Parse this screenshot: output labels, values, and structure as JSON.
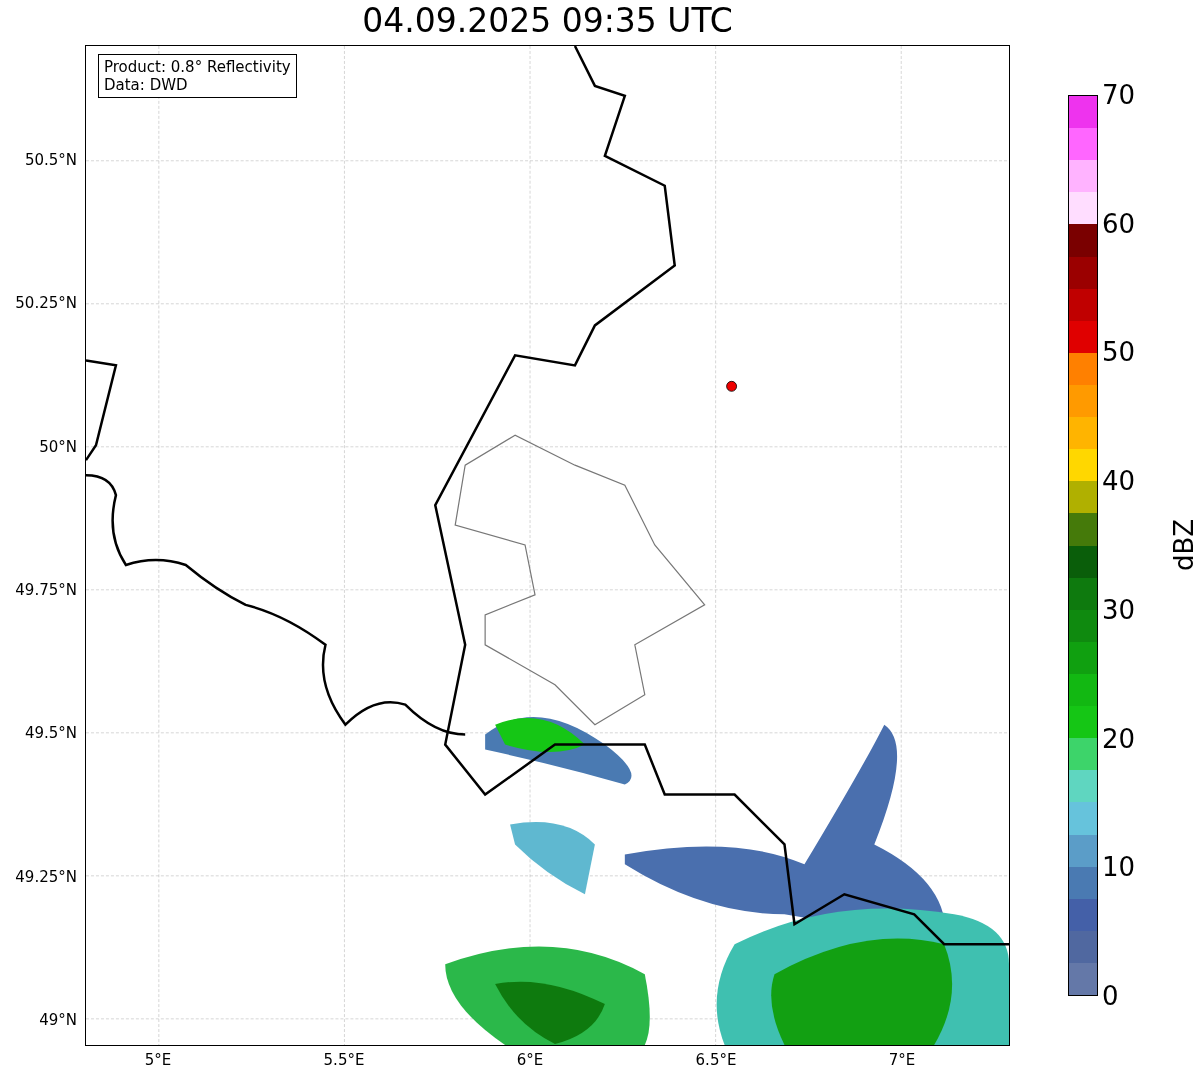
{
  "title": "04.09.2025 09:35 UTC",
  "info_box": [
    "Product: 0.8° Reflectivity",
    "Data: DWD"
  ],
  "y_ticks": [
    "50.5°N",
    "50.25°N",
    "50°N",
    "49.75°N",
    "49.5°N",
    "49.25°N",
    "49°N"
  ],
  "x_ticks": [
    "5°E",
    "5.5°E",
    "6°E",
    "6.5°E",
    "7°E"
  ],
  "colorbar": {
    "label": "dBZ",
    "ticks": [
      "70",
      "60",
      "50",
      "40",
      "30",
      "20",
      "10",
      "0"
    ],
    "segments": [
      {
        "color": "#ee33ee"
      },
      {
        "color": "#ff66ff"
      },
      {
        "color": "#ffb3ff"
      },
      {
        "color": "#ffddff"
      },
      {
        "color": "#7a0000"
      },
      {
        "color": "#9b0000"
      },
      {
        "color": "#c00000"
      },
      {
        "color": "#e00000"
      },
      {
        "color": "#ff8000"
      },
      {
        "color": "#ff9a00"
      },
      {
        "color": "#ffb400"
      },
      {
        "color": "#ffd700"
      },
      {
        "color": "#b0b000"
      },
      {
        "color": "#457a0a"
      },
      {
        "color": "#0a5e0a"
      },
      {
        "color": "#0e7a0e"
      },
      {
        "color": "#0f8a0f"
      },
      {
        "color": "#10a010"
      },
      {
        "color": "#12b812"
      },
      {
        "color": "#15c615"
      },
      {
        "color": "#3dd46a"
      },
      {
        "color": "#5fd6c0"
      },
      {
        "color": "#66c3dc"
      },
      {
        "color": "#5b9dc8"
      },
      {
        "color": "#4a7ab2"
      },
      {
        "color": "#4460a8"
      },
      {
        "color": "#5068a0"
      },
      {
        "color": "#6478a8"
      }
    ]
  }
}
